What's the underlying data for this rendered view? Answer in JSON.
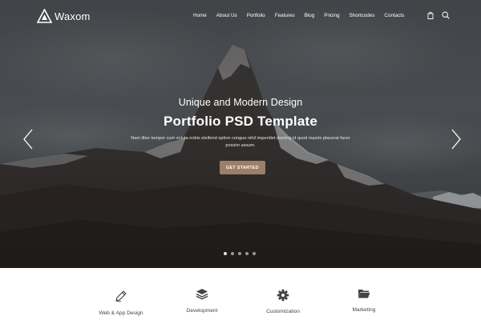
{
  "header": {
    "brand": "Waxom",
    "nav": [
      "Home",
      "About Us",
      "Portfolio",
      "Features",
      "Blog",
      "Pricing",
      "Shortcodes",
      "Contacts"
    ],
    "icons": [
      "bag-icon",
      "search-icon"
    ]
  },
  "hero": {
    "subtitle": "Unique and Modern Design",
    "title": "Portfolio PSD Template",
    "description": "Nam liber tempor cum soluta nobis eleifend option congue nihil imperdiet doming id quod mazim placerat facer possim assum.",
    "cta_label": "GET STARTED",
    "slide_count": 5,
    "active_slide": 1
  },
  "services": [
    {
      "label": "Web & App Design",
      "icon": "pencil-icon"
    },
    {
      "label": "Development",
      "icon": "layers-icon"
    },
    {
      "label": "Customization",
      "icon": "gear-icon"
    },
    {
      "label": "Marketing",
      "icon": "folder-icon"
    }
  ],
  "colors": {
    "accent": "#9c7f66",
    "hero_overlay": "#45484b",
    "text_dark": "#444444"
  }
}
